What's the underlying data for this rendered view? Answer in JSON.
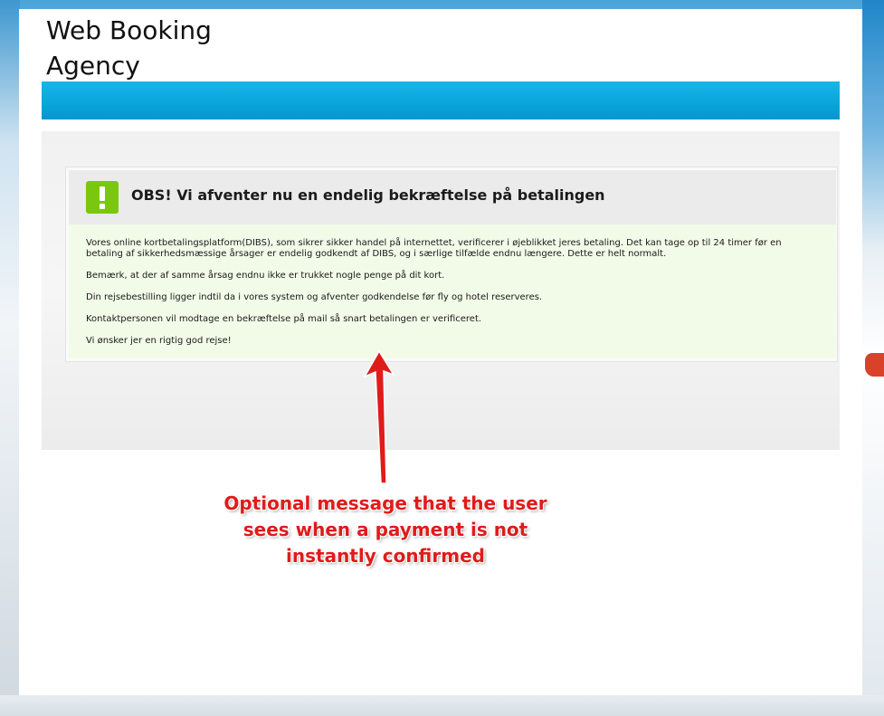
{
  "header": {
    "brand_line1": "Web Booking",
    "brand_line2": "Agency"
  },
  "notice": {
    "icon": "exclamation-icon",
    "title": "OBS! Vi afventer nu en endelig bekræftelse på betalingen",
    "paragraphs": [
      "Vores online kortbetalingsplatform(DIBS), som sikrer sikker handel på internettet, verificerer i øjeblikket jeres betaling. Det kan tage op til 24 timer før en betaling af sikkerhedsmæssige årsager er endelig godkendt af DIBS, og i særlige tilfælde endnu længere. Dette er helt normalt.",
      "Bemærk, at der af samme årsag endnu ikke er trukket nogle penge på dit kort.",
      "Din rejsebestilling ligger indtil da i vores system og afventer godkendelse før fly og hotel reserveres.",
      "Kontaktpersonen vil modtage en bekræftelse på mail så snart betalingen er verificeret.",
      "Vi ønsker jer en rigtig god rejse!"
    ]
  },
  "annotation": {
    "line1": "Optional message that the user",
    "line2": "sees when a payment is not",
    "line3": "instantly confirmed"
  },
  "colors": {
    "accent_bar": "#0aa6db",
    "icon_green": "#7bc70f",
    "annotation_red": "#e01b1b",
    "notice_body_bg": "#f2fbe8"
  }
}
